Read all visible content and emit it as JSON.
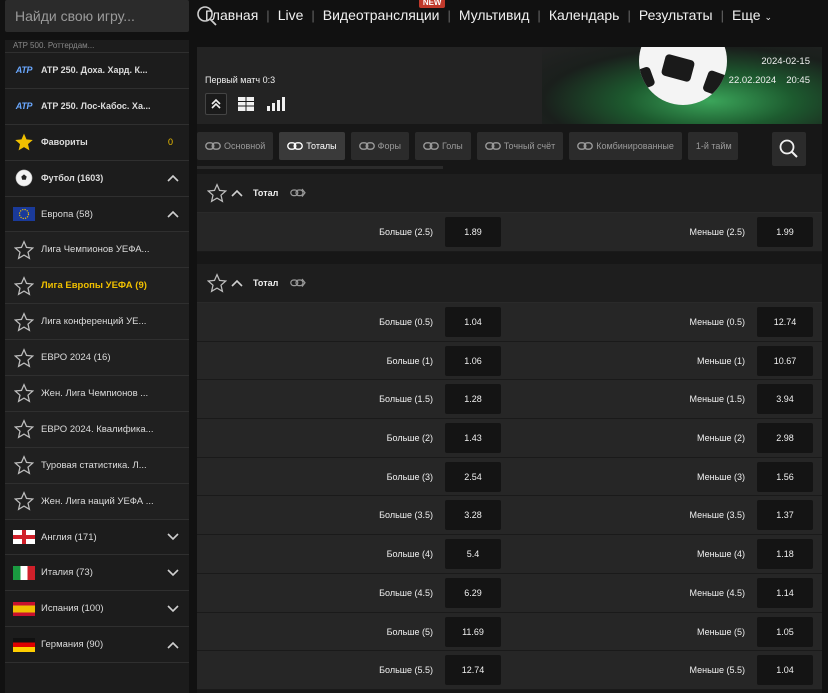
{
  "search": {
    "placeholder": "Найди свою игру..."
  },
  "nav": {
    "items": [
      "Главная",
      "Live",
      "Видеотрансляции",
      "Мультивид",
      "Календарь",
      "Результаты",
      "Еще"
    ],
    "badge": "NEW"
  },
  "sidebar": {
    "partial_label": "ATP 500. Роттердам...",
    "items": [
      {
        "label": "ATP 250. Доха. Хард. К...",
        "icon": "atp-logo"
      },
      {
        "label": "ATP 250. Лос-Кабос. Ха...",
        "icon": "atp-logo"
      },
      {
        "label": "Фавориты",
        "count": "0",
        "icon": "star-filled-icon"
      },
      {
        "label": "Футбол (1603)",
        "icon": "soccer-ball-icon"
      },
      {
        "label": "Европа (58)",
        "icon": "eu-flag"
      },
      {
        "label": "Лига Чемпионов УЕФА...",
        "icon": "star-outline-icon"
      },
      {
        "label": "Лига Европы УЕФА (9)",
        "icon": "star-outline-icon"
      },
      {
        "label": "Лига конференций УЕ...",
        "icon": "star-outline-icon"
      },
      {
        "label": "ЕВРО 2024 (16)",
        "icon": "star-outline-icon"
      },
      {
        "label": "Жен. Лига Чемпионов ...",
        "icon": "star-outline-icon"
      },
      {
        "label": "ЕВРО 2024. Квалифика...",
        "icon": "star-outline-icon"
      },
      {
        "label": "Туровая статистика. Л...",
        "icon": "star-outline-icon"
      },
      {
        "label": "Жен. Лига наций УЕФА ...",
        "icon": "star-outline-icon"
      },
      {
        "label": "Англия (171)",
        "icon": "england-flag"
      },
      {
        "label": "Италия (73)",
        "icon": "italy-flag"
      },
      {
        "label": "Испания (100)",
        "icon": "spain-flag"
      },
      {
        "label": "Германия (90)",
        "icon": "germany-flag"
      }
    ]
  },
  "match": {
    "title": "Первый матч 0:3",
    "date_short": "2024-02-15",
    "date": "22.02.2024",
    "time": "20:45"
  },
  "tabs": [
    "Основной",
    "Тоталы",
    "Форы",
    "Голы",
    "Точный счёт",
    "Комбинированные",
    "1-й тайм"
  ],
  "active_tab": "Тоталы",
  "sections": [
    {
      "title": "Тотал",
      "rows": [
        {
          "over_label": "Больше (2.5)",
          "over_odd": "1.89",
          "under_label": "Меньше (2.5)",
          "under_odd": "1.99"
        }
      ]
    },
    {
      "title": "Тотал",
      "rows": [
        {
          "over_label": "Больше (0.5)",
          "over_odd": "1.04",
          "under_label": "Меньше (0.5)",
          "under_odd": "12.74"
        },
        {
          "over_label": "Больше (1)",
          "over_odd": "1.06",
          "under_label": "Меньше (1)",
          "under_odd": "10.67"
        },
        {
          "over_label": "Больше (1.5)",
          "over_odd": "1.28",
          "under_label": "Меньше (1.5)",
          "under_odd": "3.94"
        },
        {
          "over_label": "Больше (2)",
          "over_odd": "1.43",
          "under_label": "Меньше (2)",
          "under_odd": "2.98"
        },
        {
          "over_label": "Больше (3)",
          "over_odd": "2.54",
          "under_label": "Меньше (3)",
          "under_odd": "1.56"
        },
        {
          "over_label": "Больше (3.5)",
          "over_odd": "3.28",
          "under_label": "Меньше (3.5)",
          "under_odd": "1.37"
        },
        {
          "over_label": "Больше (4)",
          "over_odd": "5.4",
          "under_label": "Меньше (4)",
          "under_odd": "1.18"
        },
        {
          "over_label": "Больше (4.5)",
          "over_odd": "6.29",
          "under_label": "Меньше (4.5)",
          "under_odd": "1.14"
        },
        {
          "over_label": "Больше (5)",
          "over_odd": "11.69",
          "under_label": "Меньше (5)",
          "under_odd": "1.05"
        },
        {
          "over_label": "Больше (5.5)",
          "over_odd": "12.74",
          "under_label": "Меньше (5.5)",
          "under_odd": "1.04"
        }
      ]
    }
  ],
  "colors": {
    "accent": "#f0c000",
    "badge": "#c0392b",
    "background": "#111111",
    "panel": "#262626"
  }
}
